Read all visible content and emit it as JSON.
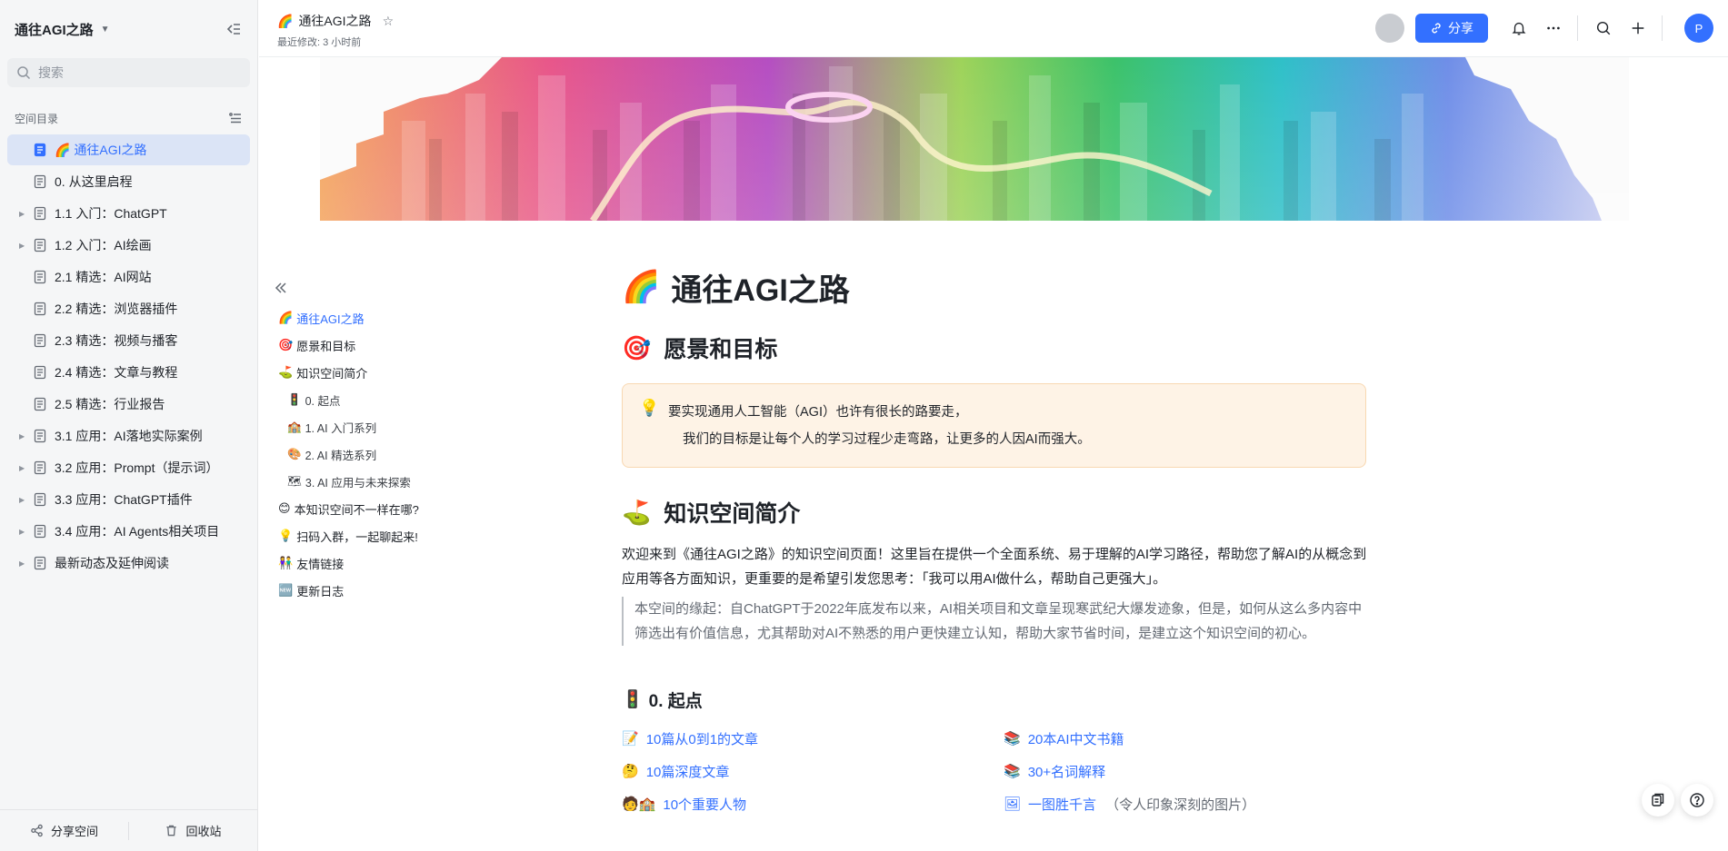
{
  "sidebar": {
    "space_title": "通往AGI之路",
    "search_placeholder": "搜索",
    "directory_label": "空间目录",
    "items": [
      {
        "label": "通往AGI之路",
        "emoji": "🌈",
        "expandable": false,
        "active": true
      },
      {
        "label": "0. 从这里启程",
        "expandable": false,
        "active": false
      },
      {
        "label": "1.1 入门：ChatGPT",
        "expandable": true,
        "active": false
      },
      {
        "label": "1.2 入门：AI绘画",
        "expandable": true,
        "active": false
      },
      {
        "label": "2.1 精选：AI网站",
        "expandable": false,
        "active": false
      },
      {
        "label": "2.2 精选：浏览器插件",
        "expandable": false,
        "active": false
      },
      {
        "label": "2.3 精选：视频与播客",
        "expandable": false,
        "active": false
      },
      {
        "label": "2.4 精选：文章与教程",
        "expandable": false,
        "active": false
      },
      {
        "label": "2.5 精选：行业报告",
        "expandable": false,
        "active": false
      },
      {
        "label": "3.1 应用：AI落地实际案例",
        "expandable": true,
        "active": false
      },
      {
        "label": "3.2 应用：Prompt（提示词）",
        "expandable": true,
        "active": false
      },
      {
        "label": "3.3 应用：ChatGPT插件",
        "expandable": true,
        "active": false
      },
      {
        "label": "3.4 应用：AI Agents相关项目",
        "expandable": true,
        "active": false
      },
      {
        "label": "最新动态及延伸阅读",
        "expandable": true,
        "active": false
      }
    ],
    "footer": {
      "share_space": "分享空间",
      "recycle_bin": "回收站"
    }
  },
  "topbar": {
    "title_emoji": "🌈",
    "title": "通往AGI之路",
    "last_modified": "最近修改: 3 小时前",
    "share_label": "分享",
    "user_initial": "P"
  },
  "outline": [
    {
      "label": "通往AGI之路",
      "emoji": "🌈",
      "level": 1,
      "active": true
    },
    {
      "label": "愿景和目标",
      "emoji": "🎯",
      "level": 1,
      "active": false
    },
    {
      "label": "知识空间简介",
      "emoji": "⛳",
      "level": 1,
      "active": false
    },
    {
      "label": "0. 起点",
      "emoji": "🚦",
      "level": 2,
      "active": false
    },
    {
      "label": "1. AI 入门系列",
      "emoji": "🏫",
      "level": 2,
      "active": false
    },
    {
      "label": "2. AI 精选系列",
      "emoji": "🎨",
      "level": 2,
      "active": false
    },
    {
      "label": "3. AI 应用与未来探索",
      "emoji": "🗺",
      "level": 2,
      "active": false
    },
    {
      "label": "本知识空间不一样在哪?",
      "emoji": "😊",
      "level": 1,
      "active": false
    },
    {
      "label": "扫码入群，一起聊起来!",
      "emoji": "💡",
      "level": 1,
      "active": false
    },
    {
      "label": "友情链接",
      "emoji": "👫",
      "level": 1,
      "active": false
    },
    {
      "label": "更新日志",
      "emoji": "🆕",
      "level": 1,
      "active": false
    }
  ],
  "main": {
    "h1": {
      "emoji": "🌈",
      "text": "通往AGI之路"
    },
    "vision": {
      "emoji": "🎯",
      "heading": "愿景和目标",
      "callout_line1": "要实现通用人工智能（AGI）也许有很长的路要走，",
      "callout_line2": "我们的目标是让每个人的学习过程少走弯路，让更多的人因AI而强大。"
    },
    "intro": {
      "emoji": "⛳",
      "heading": "知识空间简介",
      "paragraph": "欢迎来到《通往AGI之路》的知识空间页面！这里旨在提供一个全面系统、易于理解的AI学习路径，帮助您了解AI的从概念到应用等各方面知识，更重要的是希望引发您思考：「我可以用AI做什么，帮助自己更强大」。",
      "quote": "本空间的缘起：自ChatGPT于2022年底发布以来，AI相关项目和文章呈现寒武纪大爆发迹象，但是，如何从这么多内容中筛选出有价值信息，尤其帮助对AI不熟悉的用户更快建立认知，帮助大家节省时间，是建立这个知识空间的初心。"
    },
    "start": {
      "emoji": "🚦",
      "heading": "0. 起点",
      "links": [
        {
          "emoji": "📝",
          "text": "10篇从0到1的文章",
          "note": ""
        },
        {
          "emoji": "📚",
          "text": "20本AI中文书籍",
          "note": ""
        },
        {
          "emoji": "🤔",
          "text": "10篇深度文章",
          "note": ""
        },
        {
          "emoji": "📚",
          "text": "30+名词解释",
          "note": ""
        },
        {
          "emoji": "🧑🏫",
          "text": "10个重要人物",
          "note": ""
        },
        {
          "emoji": "🖼",
          "text": "一图胜千言",
          "note": "（令人印象深刻的图片）"
        }
      ]
    }
  },
  "colors": {
    "accent": "#3370ff",
    "sidebar_bg": "#f5f6f7",
    "active_item_bg": "#dbe4f6",
    "callout_bg": "#fef3e6",
    "callout_border": "#f8d8b2"
  }
}
